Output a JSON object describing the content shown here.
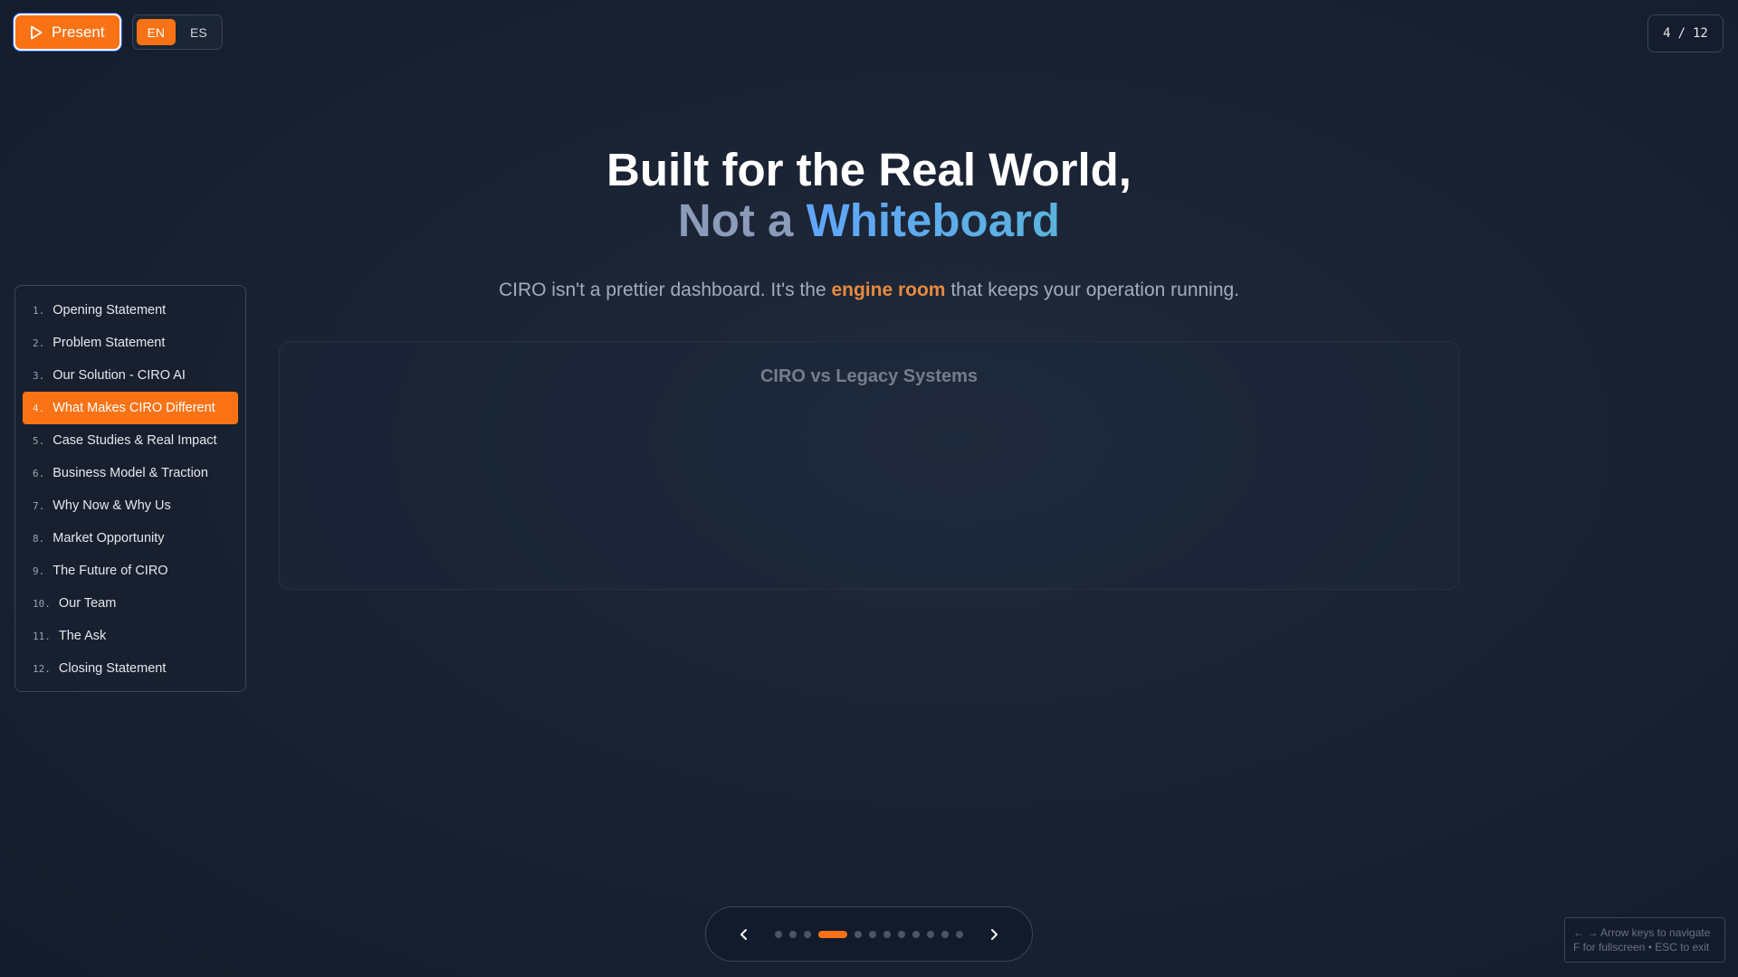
{
  "controls": {
    "present_label": "Present",
    "languages": [
      "EN",
      "ES"
    ],
    "active_language": "EN"
  },
  "counter": {
    "current": "4",
    "separator": "/",
    "total": "12"
  },
  "slide": {
    "title_line1": "Built for the Real World,",
    "title_line2_muted": "Not a",
    "title_line2_accent": "Whiteboard",
    "subtitle_before": "CIRO isn't a prettier dashboard. It's the",
    "subtitle_highlight": "engine room",
    "subtitle_after": "that keeps your operation running.",
    "panel_title": "CIRO vs Legacy Systems"
  },
  "toc": {
    "items": [
      {
        "num": "1.",
        "label": "Opening Statement"
      },
      {
        "num": "2.",
        "label": "Problem Statement"
      },
      {
        "num": "3.",
        "label": "Our Solution - CIRO AI"
      },
      {
        "num": "4.",
        "label": "What Makes CIRO Different"
      },
      {
        "num": "5.",
        "label": "Case Studies & Real Impact"
      },
      {
        "num": "6.",
        "label": "Business Model & Traction"
      },
      {
        "num": "7.",
        "label": "Why Now & Why Us"
      },
      {
        "num": "8.",
        "label": "Market Opportunity"
      },
      {
        "num": "9.",
        "label": "The Future of CIRO"
      },
      {
        "num": "10.",
        "label": "Our Team"
      },
      {
        "num": "11.",
        "label": "The Ask"
      },
      {
        "num": "12.",
        "label": "Closing Statement"
      }
    ],
    "active_index": 3
  },
  "hint": {
    "line1": "← → Arrow keys to navigate",
    "line2": "F for fullscreen • ESC to exit"
  },
  "colors": {
    "accent": "#f97316",
    "highlight": "#e88a3e",
    "background": "#1a2333"
  }
}
